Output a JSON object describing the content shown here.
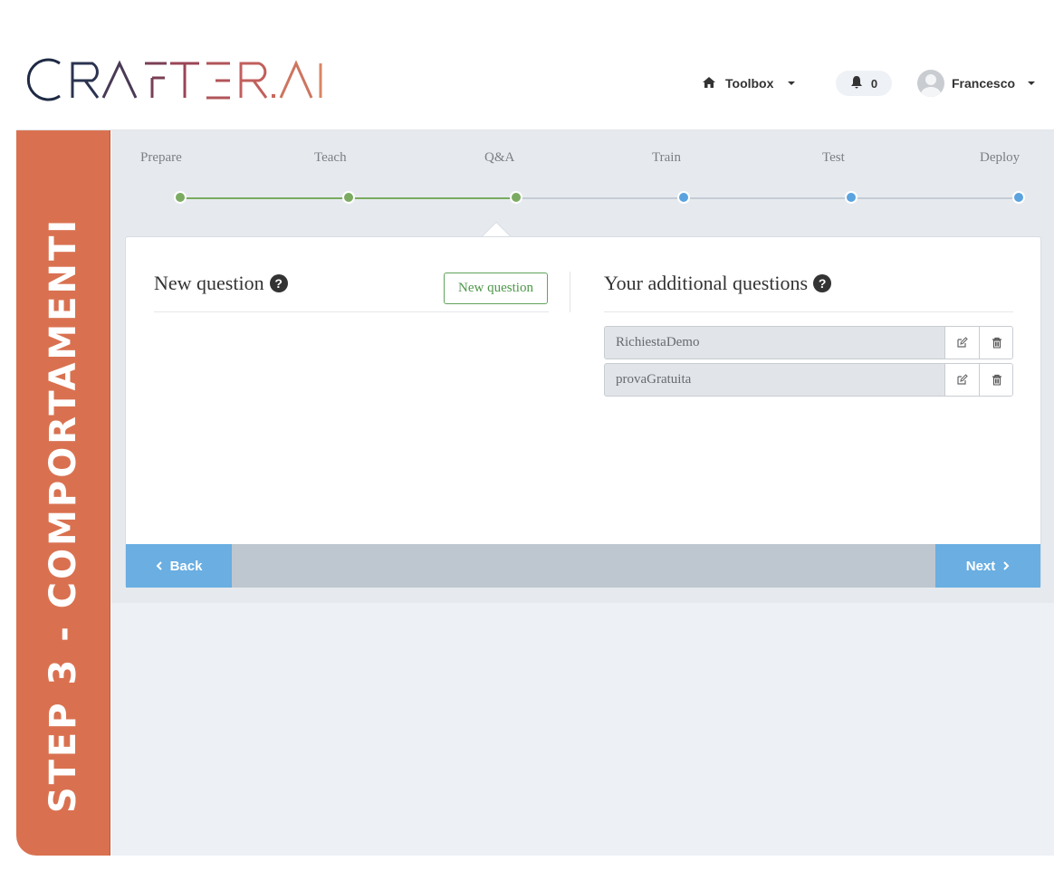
{
  "header": {
    "logo_text": "CRAFTER.AI",
    "toolbox_label": "Toolbox",
    "notifications_count": "0",
    "user_name": "Francesco"
  },
  "sidebar_banner": "STEP 3 - COMPORTAMENTI",
  "steps": [
    {
      "label": "Prepare",
      "status": "done"
    },
    {
      "label": "Teach",
      "status": "done"
    },
    {
      "label": "Q&A",
      "status": "current"
    },
    {
      "label": "Train",
      "status": "pending"
    },
    {
      "label": "Test",
      "status": "pending"
    },
    {
      "label": "Deploy",
      "status": "pending"
    }
  ],
  "colors": {
    "done": "#7aab61",
    "pending": "#5aa3de",
    "line_pending": "#c5ccd4",
    "accent_orange": "#d97150",
    "nav_button": "#6aaee2"
  },
  "new_question": {
    "title": "New question",
    "button_label": "New question"
  },
  "additional": {
    "title": "Your additional questions",
    "items": [
      {
        "name": "RichiestaDemo"
      },
      {
        "name": "provaGratuita"
      }
    ]
  },
  "footer": {
    "back_label": "Back",
    "next_label": "Next"
  },
  "icons": [
    "home-icon",
    "bell-icon",
    "avatar",
    "question-circle-icon",
    "edit-icon",
    "trash-icon",
    "chevron-left-icon",
    "chevron-right-icon"
  ]
}
